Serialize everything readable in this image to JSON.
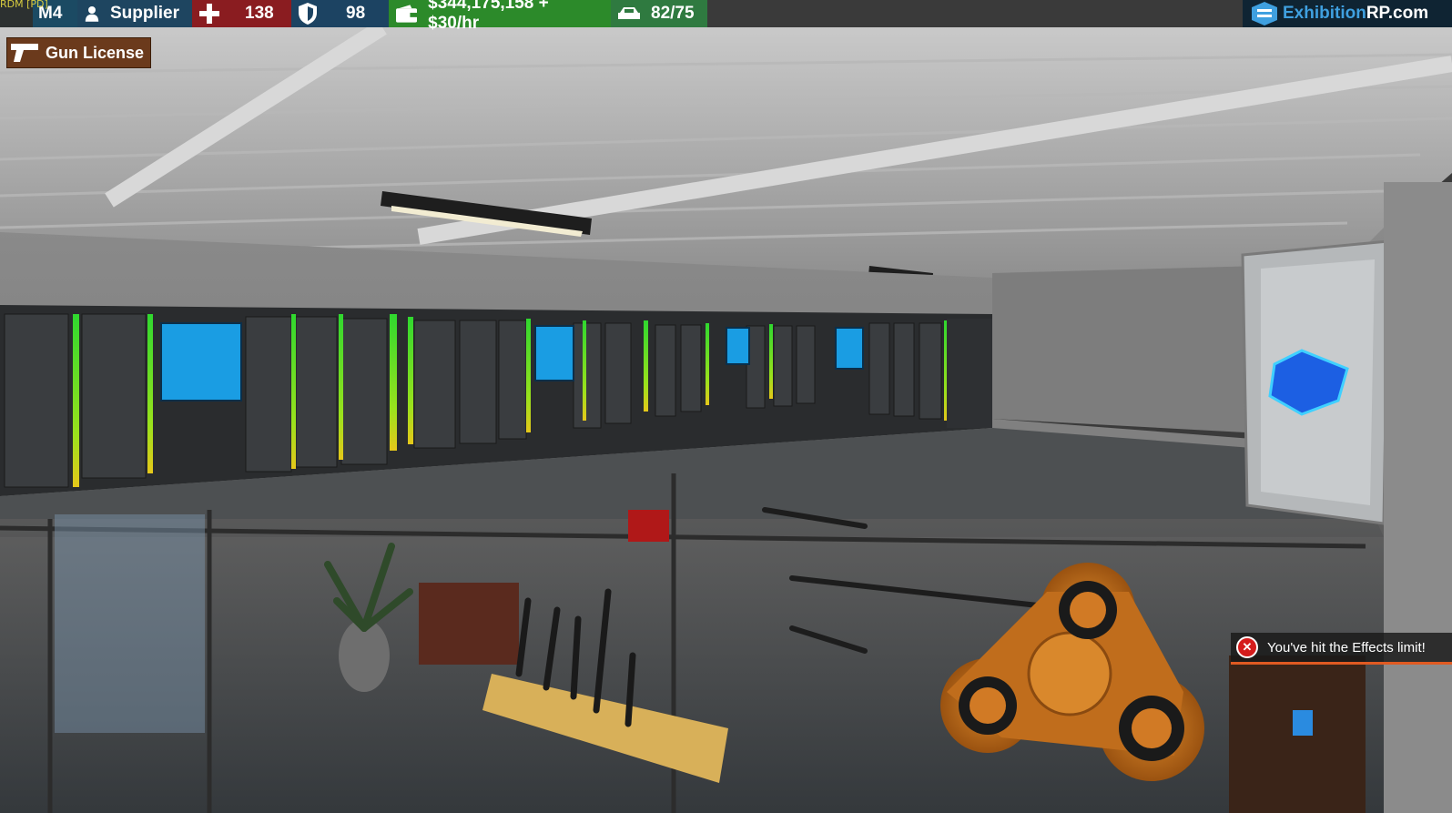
{
  "hud": {
    "mode_tag": "RDM [PD]",
    "weapon": "M4",
    "job": "Supplier",
    "health": "138",
    "armor": "98",
    "money": "$344,175,158 + $30/hr",
    "vehicles": "82/75",
    "brand_part1": "Exhibition",
    "brand_part2": "RP.com"
  },
  "license": {
    "label": "Gun License"
  },
  "notification": {
    "text": "You've hit the Effects limit!"
  },
  "colors": {
    "health": "#8a1c20",
    "money": "#2c8a2a",
    "brand_accent": "#3fa0e0",
    "notify_accent": "#e05a22",
    "license_bg": "#6b3a1c"
  },
  "icons": [
    "user-icon",
    "health-cross-icon",
    "shield-icon",
    "wallet-icon",
    "car-icon",
    "pistol-icon",
    "error-icon",
    "exhibitionrp-logo-icon",
    "fidget-spinner"
  ]
}
